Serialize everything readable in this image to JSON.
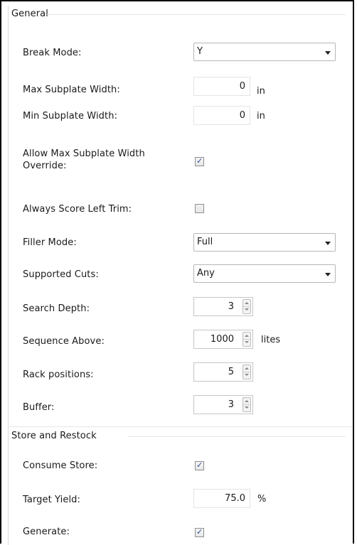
{
  "sections": {
    "general": "General",
    "store": "Store and Restock"
  },
  "fields": {
    "break_mode": {
      "label": "Break Mode:",
      "value": "Y"
    },
    "max_subplate_width": {
      "label": "Max Subplate Width:",
      "value": "0",
      "unit": "in"
    },
    "min_subplate_width": {
      "label": "Min Subplate Width:",
      "value": "0",
      "unit": "in"
    },
    "allow_max_override": {
      "label_line1": "Allow Max Subplate Width",
      "label_line2": "Override:",
      "checked": true
    },
    "always_score_left_trim": {
      "label": "Always Score Left Trim:",
      "checked": false
    },
    "filler_mode": {
      "label": "Filler Mode:",
      "value": "Full"
    },
    "supported_cuts": {
      "label": "Supported Cuts:",
      "value": "Any"
    },
    "search_depth": {
      "label": "Search Depth:",
      "value": "3"
    },
    "sequence_above": {
      "label": "Sequence Above:",
      "value": "1000",
      "unit": "lites"
    },
    "rack_positions": {
      "label": "Rack positions:",
      "value": "5"
    },
    "buffer": {
      "label": "Buffer:",
      "value": "3"
    },
    "consume_store": {
      "label": "Consume Store:",
      "checked": true
    },
    "target_yield": {
      "label": "Target Yield:",
      "value": "75.0",
      "unit": "%"
    },
    "generate": {
      "label": "Generate:",
      "checked": true
    }
  },
  "icons": {
    "checkmark": "checkmark-icon",
    "dropdown": "chevron-down-icon",
    "spin_up": "spin-up-icon",
    "spin_down": "spin-down-icon"
  }
}
